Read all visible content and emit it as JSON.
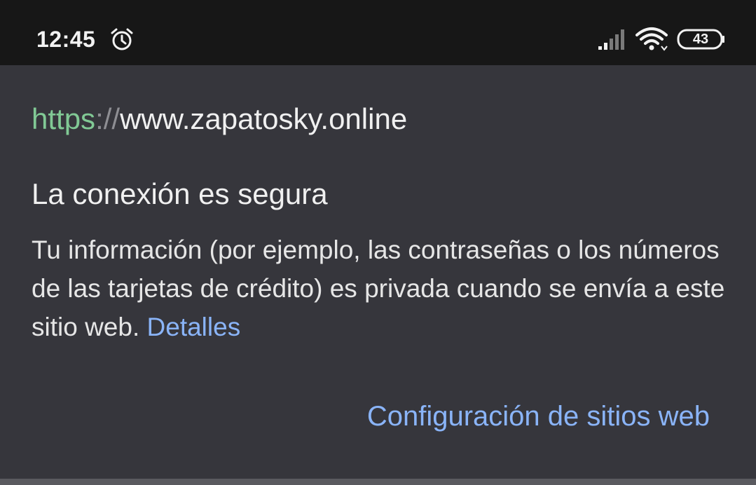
{
  "status_bar": {
    "time": "12:45",
    "battery_level": "43",
    "icons": [
      "alarm-icon",
      "signal-icon",
      "wifi-icon",
      "battery-icon"
    ]
  },
  "page_info": {
    "url_scheme": "https",
    "url_separator": "://",
    "url_host": "www.zapatosky.online",
    "title": "La conexión es segura",
    "description": "Tu información (por ejemplo, las contraseñas o los números de las tarjetas de crédito) es privada cuando se envía a este sitio web.",
    "details_link": "Detalles",
    "site_settings_link": "Configuración de sitios web"
  },
  "colors": {
    "background": "#36363c",
    "status_bar": "#171717",
    "secure_scheme": "#81c995",
    "link": "#8ab4f8"
  }
}
